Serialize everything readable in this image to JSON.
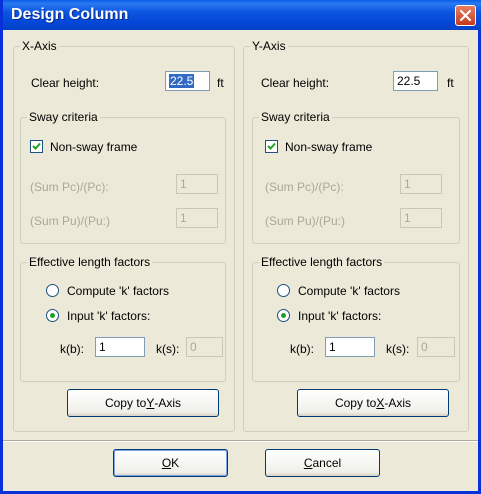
{
  "window": {
    "title": "Design Column"
  },
  "x_axis": {
    "title": "X-Axis",
    "clear_height_label": "Clear height:",
    "clear_height_value": "22.5",
    "clear_height_unit": "ft",
    "sway": {
      "title": "Sway criteria",
      "non_sway_label": "Non-sway frame",
      "non_sway_checked": true,
      "sum_pc_label": "(Sum Pc)/(Pc):",
      "sum_pc_value": "1",
      "sum_pu_label": "(Sum Pu)/(Pu:)",
      "sum_pu_value": "1"
    },
    "elf": {
      "title": "Effective length factors",
      "compute_label": "Compute 'k' factors",
      "input_label": "Input 'k' factors:",
      "selected": "input",
      "kb_label": "k(b):",
      "kb_value": "1",
      "ks_label": "k(s):",
      "ks_value": "0"
    },
    "copy_button": {
      "prefix": "Copy to ",
      "mnemonic": "Y",
      "suffix": "-Axis"
    }
  },
  "y_axis": {
    "title": "Y-Axis",
    "clear_height_label": "Clear height:",
    "clear_height_value": "22.5",
    "clear_height_unit": "ft",
    "sway": {
      "title": "Sway criteria",
      "non_sway_label": "Non-sway frame",
      "non_sway_checked": true,
      "sum_pc_label": "(Sum Pc)/(Pc):",
      "sum_pc_value": "1",
      "sum_pu_label": "(Sum Pu)/(Pu:)",
      "sum_pu_value": "1"
    },
    "elf": {
      "title": "Effective length factors",
      "compute_label": "Compute 'k' factors",
      "input_label": "Input 'k' factors:",
      "selected": "input",
      "kb_label": "k(b):",
      "kb_value": "1",
      "ks_label": "k(s):",
      "ks_value": "0"
    },
    "copy_button": {
      "prefix": "Copy to ",
      "mnemonic": "X",
      "suffix": "-Axis"
    }
  },
  "ok_button": {
    "mnemonic": "O",
    "rest": "K"
  },
  "cancel_button": {
    "mnemonic": "C",
    "rest": "ancel"
  },
  "colors": {
    "titlebar": "#0A5DE8",
    "face": "#ECE9D8",
    "selection": "#316AC5",
    "radio_dot": "#21A121"
  },
  "icons": {
    "close": "close-icon",
    "check": "checkmark-icon"
  }
}
